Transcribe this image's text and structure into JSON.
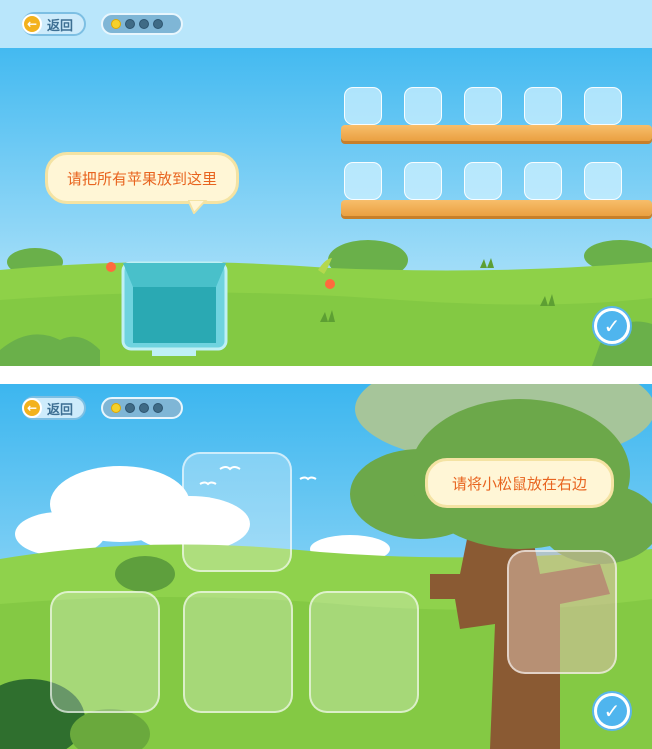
{
  "scene1": {
    "back_label": "返回",
    "back_arrow": "←",
    "progress": {
      "total": 4,
      "current": 1
    },
    "bubble_text": "请把所有苹果放到这里",
    "shelf_rows": 2,
    "slots_per_row": 5,
    "basket_icon": "basket-icon",
    "check_icon": "✓",
    "colors": {
      "sky_top": "#b9e6fb",
      "sky": "#56c2f1",
      "grass": "#8ed148",
      "plank": "#f1b15b"
    }
  },
  "scene2": {
    "back_label": "返回",
    "back_arrow": "←",
    "progress": {
      "total": 4,
      "current": 1
    },
    "bubble_text": "请将小松鼠放在右边",
    "drop_zone_count": 5,
    "tree_icon": "tree-icon",
    "check_icon": "✓",
    "colors": {
      "sky": "#55c3f0",
      "grass": "#88cd4a",
      "tree_trunk": "#8a5a33",
      "foliage": "#6ca84a"
    }
  }
}
